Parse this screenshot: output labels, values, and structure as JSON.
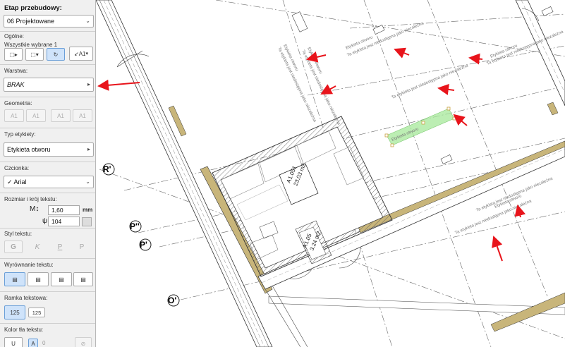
{
  "panel": {
    "stage_label": "Etap przebudowy:",
    "stage_value": "06 Projektowane",
    "general_label": "Ogólne:",
    "selected_label": "Wszystkie wybrane 1",
    "anchor_btn": "A1",
    "layer_label": "Warstwa:",
    "layer_value": "BRAK",
    "geometry_label": "Geometria:",
    "geo_buttons": [
      "A1",
      "A1",
      "A1",
      "A1"
    ],
    "label_type_label": "Typ etykiety:",
    "label_type_value": "Etykieta otworu",
    "font_label": "Czcionka:",
    "font_value": "✓ Arial",
    "size_label": "Rozmiar i kròj tekstu:",
    "size_value": "1,60",
    "size_unit": "mm",
    "width_value": "104",
    "style_label": "Styl tekstu:",
    "style_buttons": [
      "G",
      "K",
      "P",
      "P"
    ],
    "align_label": "Wyrównanie tekstu:",
    "frame_label": "Ramka tekstowa:",
    "frame_buttons": [
      "125",
      "125"
    ],
    "bg_label": "Kolor tła tekstu:",
    "bg_buttons": [
      "U",
      "A",
      "0",
      "⊘"
    ]
  },
  "canvas": {
    "grid_bubbles": [
      "R'",
      "P''",
      "P'",
      "O'"
    ],
    "room1": {
      "code": "A1.051",
      "area": "23.03 m2"
    },
    "room2": {
      "code": "A1.05",
      "area": "3.24 m2"
    },
    "tag_title": "Etykieta otworu",
    "tag_note": "Ta etykieta jest niedostępna jako niezależna",
    "selected_tag": "Etykieta otworu"
  },
  "colors": {
    "arrow": "#e8141b",
    "wall_fill": "#c8b57a",
    "selection": "#a6e89a"
  }
}
